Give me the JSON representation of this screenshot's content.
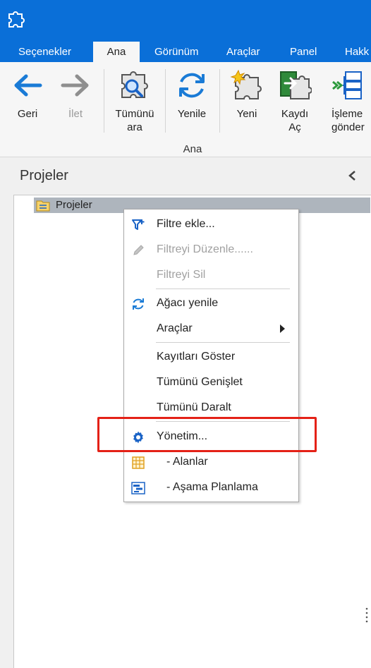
{
  "app": {
    "icon": "puzzle-app-icon"
  },
  "tabs": [
    {
      "label": "Seçenekler",
      "active": false
    },
    {
      "label": "Ana",
      "active": true
    },
    {
      "label": "Görünüm",
      "active": false
    },
    {
      "label": "Araçlar",
      "active": false
    },
    {
      "label": "Panel",
      "active": false
    },
    {
      "label": "Hakk",
      "active": false
    }
  ],
  "ribbon": {
    "group_label": "Ana",
    "buttons": [
      {
        "label": "Geri",
        "icon": "arrow-left-icon",
        "enabled": true
      },
      {
        "label": "İlet",
        "icon": "arrow-right-icon",
        "enabled": false
      },
      {
        "label": "Tümünü\nara",
        "icon": "puzzle-search-icon",
        "enabled": true
      },
      {
        "label": "Yenile",
        "icon": "refresh-icon",
        "enabled": true
      },
      {
        "label": "Yeni",
        "icon": "puzzle-new-icon",
        "enabled": true
      },
      {
        "label": "Kaydı\nAç",
        "icon": "open-record-icon",
        "enabled": true
      },
      {
        "label": "İşleme\ngönder",
        "icon": "workflow-send-icon",
        "enabled": true
      }
    ]
  },
  "panel": {
    "title": "Projeler",
    "collapse_icon": "chevron-left-icon"
  },
  "tree": {
    "root_label": "Projeler",
    "root_icon": "folder-tree-icon"
  },
  "context_menu": {
    "items": [
      {
        "label": "Filtre ekle...",
        "icon": "filter-add-icon",
        "enabled": true
      },
      {
        "label": "Filtreyi Düzenle......",
        "icon": "pencil-icon",
        "enabled": false
      },
      {
        "label": "Filtreyi Sil",
        "icon": "",
        "enabled": false
      },
      {
        "label": "Ağacı yenile",
        "icon": "refresh-icon",
        "enabled": true
      },
      {
        "label": "Araçlar",
        "icon": "",
        "enabled": true,
        "submenu": true
      },
      {
        "label": "Kayıtları Göster",
        "icon": "",
        "enabled": true
      },
      {
        "label": "Tümünü Genişlet",
        "icon": "",
        "enabled": true
      },
      {
        "label": "Tümünü Daralt",
        "icon": "",
        "enabled": true
      },
      {
        "label": "Yönetim...",
        "icon": "gear-icon",
        "enabled": true,
        "highlighted": true
      },
      {
        "label": "- Alanlar",
        "icon": "table-grid-icon",
        "enabled": true
      },
      {
        "label": "- Aşama Planlama",
        "icon": "stage-planning-icon",
        "enabled": true
      }
    ]
  },
  "colors": {
    "accent": "#0a6fd8",
    "highlight": "#e42117",
    "selected_row": "#aeb5bd"
  }
}
